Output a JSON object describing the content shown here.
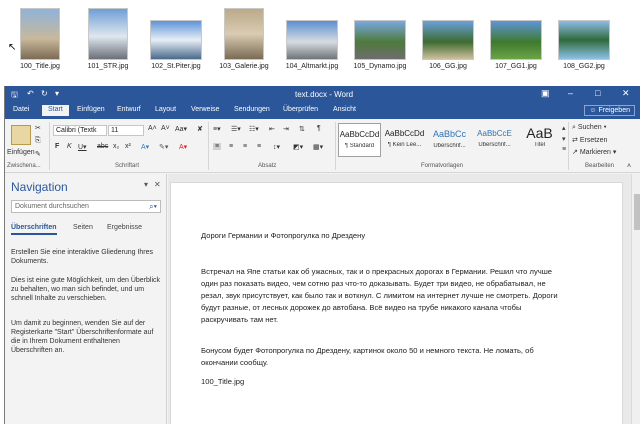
{
  "explorer": {
    "files": [
      {
        "label": "100_Title.jpg"
      },
      {
        "label": "101_STR.jpg"
      },
      {
        "label": "102_St.Piter.jpg"
      },
      {
        "label": "103_Galerie.jpg"
      },
      {
        "label": "104_Altmarkt.jpg"
      },
      {
        "label": "105_Dynamo.jpg"
      },
      {
        "label": "106_GG.jpg"
      },
      {
        "label": "107_GG1.jpg"
      },
      {
        "label": "108_GG2.jpg"
      }
    ]
  },
  "titlebar": {
    "document": "text.docx - Word"
  },
  "tabs": [
    "Datei",
    "Start",
    "Einfügen",
    "Entwurf",
    "Layout",
    "Verweise",
    "Sendungen",
    "Überprüfen",
    "Ansicht"
  ],
  "share_label": "Freigeben",
  "ribbon": {
    "paste": "Einfügen",
    "clipboard_group": "Zwischena...",
    "font_name": "Calibri (Textk",
    "font_size": "11",
    "font_group": "Schriftart",
    "paragraph_group": "Absatz",
    "styles_group": "Formatvorlagen",
    "styles": [
      {
        "preview": "AaBbCcDd",
        "name": "¶ Standard"
      },
      {
        "preview": "AaBbCcDd",
        "name": "¶ Kein Lee..."
      },
      {
        "preview": "AaBbCc",
        "name": "Überschrif..."
      },
      {
        "preview": "AaBbCcE",
        "name": "Überschrif..."
      },
      {
        "preview": "AaB",
        "name": "Titel"
      }
    ],
    "search": "Suchen",
    "replace": "Ersetzen",
    "select": "Markieren",
    "edit_group": "Bearbeiten"
  },
  "navigation": {
    "title": "Navigation",
    "search_placeholder": "Dokument durchsuchen",
    "tabs": [
      "Überschriften",
      "Seiten",
      "Ergebnisse"
    ],
    "paragraphs": [
      "Erstellen Sie eine interaktive Gliederung Ihres Dokuments.",
      "Dies ist eine gute Möglichkeit, um den Überblick zu behalten, wo man sich befindet, und um schnell Inhalte zu verschieben.",
      "Um damit zu beginnen, wenden Sie auf der Registerkarte \"Start\" Überschriftenformate auf die in Ihrem Dokument enthaltenen Überschriften an."
    ]
  },
  "document": {
    "paragraphs": [
      "Дороги Германии и Фотопрогулка по Дрездену",
      "Встречал на Япе статьи как об ужасных, так и о прекрасных дорогах в Германии. Решил что лучше один раз показать видео, чем сотню раз что-то доказывать. Будет три видео, не обрабатывал, не резал, звук присутствует, как было так и воткнул. С лимитом на интернет лучше не смотреть. Дороги будут разные, от лесных дорожек до автобана. Всё видео на трубе никакого канала чтобы раскручивать там нет.",
      "Бонусом будет Фотопрогулка по Дрездену, картинок около 50 и немного текста. Не ломать, об окончании сообщу.",
      "100_Title.jpg"
    ]
  },
  "colors": {
    "accent": "#2b579a"
  }
}
